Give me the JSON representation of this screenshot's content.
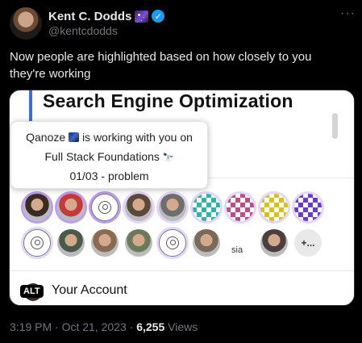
{
  "tweet": {
    "author_name": "Kent C. Dodds",
    "handle": "@kentcdodds",
    "text": "Now people are highlighted based on how closely to you they're working",
    "time": "3:19 PM",
    "date": "Oct 21, 2023",
    "views_count": "6,255",
    "views_label": "Views",
    "more_icon": "more-horizontal-icon",
    "verified_icon": "verified-badge-icon",
    "verified_glyph": "✓",
    "more_glyph": "···",
    "separator": "·"
  },
  "media": {
    "heading": "Search Engine Optimization",
    "tooltip": {
      "line1_user": "Qanoze",
      "line1_rest": "is working with you on",
      "line2": "Full Stack Foundations",
      "line2_emoji": "🔭",
      "line3": "01/03 - problem"
    },
    "avatars_row1": [
      {
        "kind": "photo",
        "highlight": "strong"
      },
      {
        "kind": "photo",
        "highlight": "strong"
      },
      {
        "kind": "anonymous",
        "highlight": "strong"
      },
      {
        "kind": "photo",
        "highlight": "soft"
      },
      {
        "kind": "photo",
        "highlight": "soft"
      },
      {
        "kind": "identicon",
        "highlight": "soft"
      },
      {
        "kind": "identicon",
        "highlight": "soft"
      },
      {
        "kind": "identicon",
        "highlight": "soft"
      },
      {
        "kind": "identicon",
        "highlight": "soft"
      }
    ],
    "avatars_row2": [
      {
        "kind": "anonymous",
        "highlight": "soft"
      },
      {
        "kind": "photo",
        "highlight": "none"
      },
      {
        "kind": "photo",
        "highlight": "none"
      },
      {
        "kind": "photo",
        "highlight": "none"
      },
      {
        "kind": "anonymous",
        "highlight": "soft"
      },
      {
        "kind": "photo",
        "highlight": "none"
      },
      {
        "kind": "broken-image",
        "highlight": "none",
        "alt_text": "sia"
      },
      {
        "kind": "photo",
        "highlight": "none"
      }
    ],
    "more_label": "+...",
    "alt_badge": "ALT",
    "account_label": "Your Account"
  },
  "colors": {
    "highlight_strong": "#b99cf3",
    "highlight_soft": "#e3d6fb",
    "accent_bar": "#3b6de0",
    "verified": "#1d9bf0"
  }
}
